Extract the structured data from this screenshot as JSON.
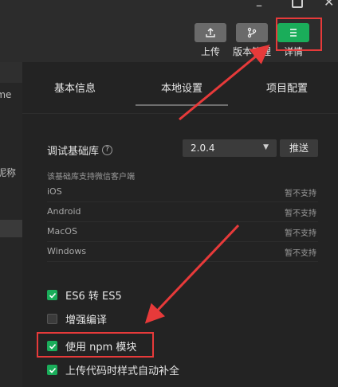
{
  "toolbar": {
    "upload_label": "上传",
    "version_label": "版本管理",
    "details_label": "详情",
    "upload_icon": "upload-icon",
    "version_icon": "branch-icon",
    "details_icon": "menu-icon"
  },
  "left_panel": {
    "text_1": "ame",
    "text_2": "户昵称"
  },
  "tabs": [
    {
      "label": "基本信息"
    },
    {
      "label": "本地设置"
    },
    {
      "label": "项目配置"
    }
  ],
  "debug_lib": {
    "label": "调试基础库",
    "version": "2.0.4",
    "push_label": "推送",
    "support_note": "该基础库支持微信客户端"
  },
  "clients": [
    {
      "name": "iOS",
      "status": "暂不支持"
    },
    {
      "name": "Android",
      "status": "暂不支持"
    },
    {
      "name": "MacOS",
      "status": "暂不支持"
    },
    {
      "name": "Windows",
      "status": "暂不支持"
    }
  ],
  "options": [
    {
      "label": "ES6 转 ES5",
      "checked": true
    },
    {
      "label": "增强编译",
      "checked": false
    },
    {
      "label": "使用 npm 模块",
      "checked": true
    },
    {
      "label": "上传代码时样式自动补全",
      "checked": true
    }
  ],
  "colors": {
    "accent_green": "#1aad5a",
    "annotation_red": "#e73a3a"
  }
}
